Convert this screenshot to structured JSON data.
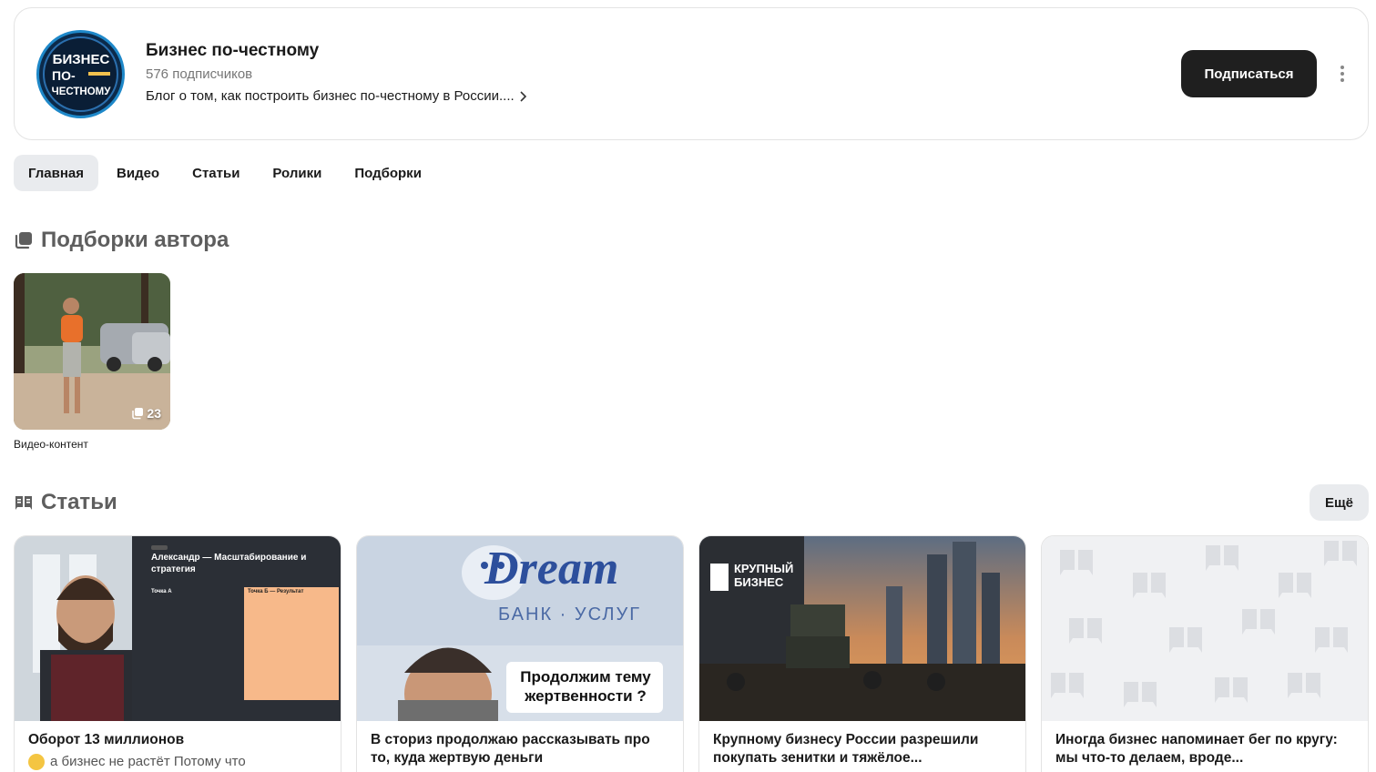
{
  "channel": {
    "avatar_text_1": "БИЗНЕС",
    "avatar_text_2": "ПО-",
    "avatar_text_3": "ЧЕСТНОМУ",
    "title": "Бизнес по-честному",
    "subscribers": "576 подписчиков",
    "description": "Блог о том, как построить бизнес по-честному в России....",
    "subscribe_label": "Подписаться"
  },
  "tabs": [
    {
      "label": "Главная",
      "active": true
    },
    {
      "label": "Видео",
      "active": false
    },
    {
      "label": "Статьи",
      "active": false
    },
    {
      "label": "Ролики",
      "active": false
    },
    {
      "label": "Подборки",
      "active": false
    }
  ],
  "collections": {
    "heading": "Подборки автора",
    "items": [
      {
        "label": "Видео-контент",
        "count": "23"
      }
    ]
  },
  "articles": {
    "heading": "Статьи",
    "more_label": "Ещё",
    "items": [
      {
        "title": "Оборот 13 миллионов",
        "snippet": "а бизнес не растёт Потому что",
        "thumb_heading": "Александр — Масштабирование и стратегия",
        "thumb_point_a": "Точка А",
        "thumb_point_b": "Точка Б — Результат"
      },
      {
        "title": "В сториз продолжаю рассказывать про то, куда жертвую деньги",
        "thumb_logo": "Dream",
        "thumb_sub": "БАНК · УСЛУГ",
        "thumb_caption": "Продолжим тему жертвенности ?"
      },
      {
        "title": "Крупному бизнесу России разрешили покупать зенитки и тяжёлое...",
        "thumb_sign": "КРУПНЫЙ БИЗНЕС"
      },
      {
        "title": "Иногда бизнес напоминает бег по кругу: мы что-то делаем, вроде..."
      }
    ]
  },
  "colors": {
    "accent_dark": "#1f1f1f",
    "tab_active_bg": "#e9ebee",
    "heading_gray": "#5e5e5e"
  }
}
